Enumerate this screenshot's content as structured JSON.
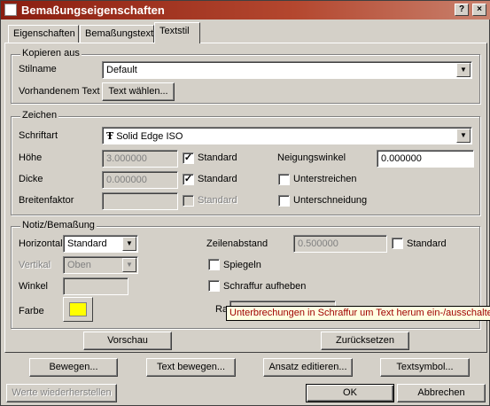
{
  "window": {
    "title": "Bemaßungseigenschaften"
  },
  "titlebar": {
    "help_label": "?",
    "close_label": "×"
  },
  "tabs": [
    {
      "label": "Eigenschaften"
    },
    {
      "label": "Bemaßungstext"
    },
    {
      "label": "Textstil"
    }
  ],
  "copy_group": {
    "title": "Kopieren aus",
    "style_label": "Stilname",
    "style_value": "Default",
    "existing_text_label": "Vorhandenem Text",
    "select_text_button": "Text wählen..."
  },
  "chars_group": {
    "title": "Zeichen",
    "font_label": "Schriftart",
    "font_icon": "Ŧ",
    "font_value": "Solid Edge ISO",
    "height_label": "Höhe",
    "height_value": "3.000000",
    "height_standard_label": "Standard",
    "thickness_label": "Dicke",
    "thickness_value": "0.000000",
    "thickness_standard_label": "Standard",
    "width_factor_label": "Breitenfaktor",
    "width_factor_value": "",
    "width_standard_label": "Standard",
    "slant_label": "Neigungswinkel",
    "slant_value": "0.000000",
    "underline_label": "Unterstreichen",
    "strikethrough_label": "Unterschneidung",
    "check_mark": "✓"
  },
  "note_group": {
    "title": "Notiz/Bemaßung",
    "horizontal_label": "Horizontal",
    "horizontal_value": "Standard",
    "vertical_label": "Vertikal",
    "vertical_value": "Oben",
    "angle_label": "Winkel",
    "angle_value": "",
    "color_label": "Farbe",
    "color_value": "#ffff00",
    "line_spacing_label": "Zeilenabstand",
    "line_spacing_value": "0.500000",
    "line_spacing_standard_label": "Standard",
    "mirror_label": "Spiegeln",
    "hatch_label": "Schraffur aufheben",
    "margin_label_partial": "Ra",
    "hatch_tooltip": "Unterbrechungen in Schraffur um Text herum ein-/ausschalten"
  },
  "panel_buttons": {
    "preview": "Vorschau",
    "reset": "Zurücksetzen"
  },
  "action_buttons": {
    "move": "Bewegen...",
    "move_text": "Text bewegen...",
    "edit_approach": "Ansatz editieren...",
    "text_symbol": "Textsymbol..."
  },
  "footer": {
    "restore_values": "Werte wiederherstellen",
    "ok": "OK",
    "cancel": "Abbrechen"
  }
}
